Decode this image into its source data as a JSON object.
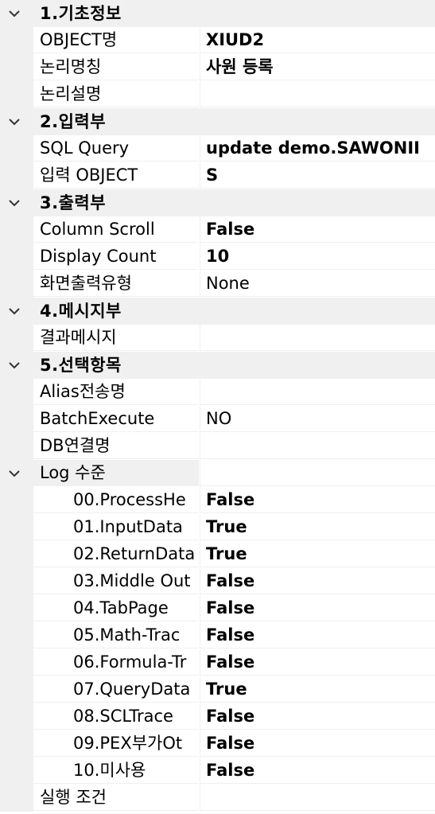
{
  "sections": [
    {
      "title": "1.기초정보",
      "rows": [
        {
          "name": "OBJECT명",
          "value": "XIUD2",
          "bold": true
        },
        {
          "name": "논리명칭",
          "value": "사원 등록",
          "bold": true
        },
        {
          "name": "논리설명",
          "value": "",
          "bold": false
        }
      ]
    },
    {
      "title": "2.입력부",
      "rows": [
        {
          "name": "SQL Query",
          "value": "update demo.SAWONII",
          "bold": true
        },
        {
          "name": "입력 OBJECT",
          "value": "S",
          "bold": true
        }
      ]
    },
    {
      "title": "3.출력부",
      "rows": [
        {
          "name": "Column Scroll",
          "value": "False",
          "bold": true
        },
        {
          "name": "Display Count",
          "value": "10",
          "bold": true
        },
        {
          "name": "화면출력유형",
          "value": "None",
          "bold": false
        }
      ]
    },
    {
      "title": "4.메시지부",
      "rows": [
        {
          "name": "결과메시지",
          "value": "",
          "bold": false
        }
      ]
    },
    {
      "title": "5.선택항목",
      "rows": [
        {
          "name": "Alias전송명",
          "value": "",
          "bold": false
        },
        {
          "name": "BatchExecute",
          "value": "NO",
          "bold": false
        },
        {
          "name": "DB연결명",
          "value": "",
          "bold": false
        }
      ]
    }
  ],
  "log": {
    "title": "Log 수준",
    "rows": [
      {
        "name": "00.ProcessHe",
        "value": "False",
        "bold": true
      },
      {
        "name": "01.InputData",
        "value": "True",
        "bold": true
      },
      {
        "name": "02.ReturnData",
        "value": "True",
        "bold": true
      },
      {
        "name": "03.Middle Out",
        "value": "False",
        "bold": true
      },
      {
        "name": "04.TabPage",
        "value": "False",
        "bold": true
      },
      {
        "name": "05.Math-Trac",
        "value": "False",
        "bold": true
      },
      {
        "name": "06.Formula-Tr",
        "value": "False",
        "bold": true
      },
      {
        "name": "07.QueryData",
        "value": "True",
        "bold": true
      },
      {
        "name": "08.SCLTrace",
        "value": "False",
        "bold": true
      },
      {
        "name": "09.PEX부가Ot",
        "value": "False",
        "bold": true
      },
      {
        "name": "10.미사용",
        "value": "False",
        "bold": true
      }
    ]
  },
  "tail": {
    "name": "실행 조건",
    "value": "",
    "bold": false
  },
  "icons": {
    "expand": "chevron-down-icon"
  },
  "colors": {
    "category_bg": "#f0f0f0",
    "gridline": "#f0f0f0"
  }
}
